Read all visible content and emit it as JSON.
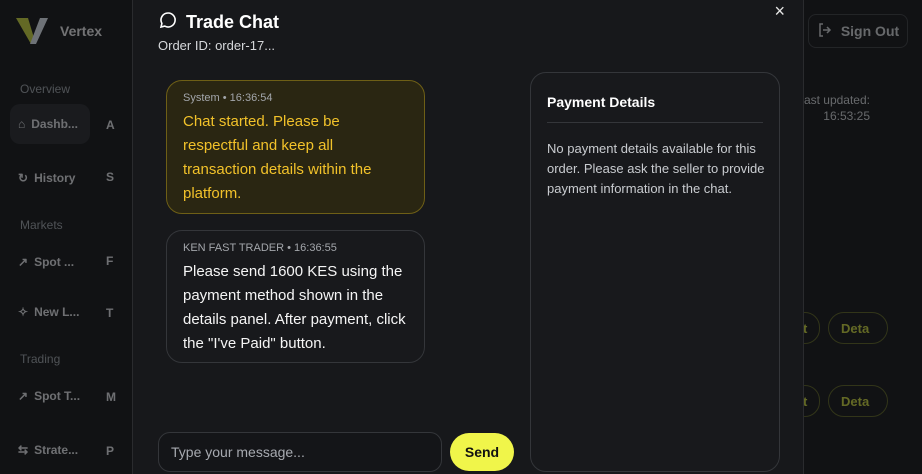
{
  "app": {
    "brand_name": "Vertex",
    "sign_out_label": "Sign Out"
  },
  "sidebar": {
    "sections": [
      "Overview",
      "Markets",
      "Trading"
    ],
    "items": [
      {
        "label": "Dashb..."
      },
      {
        "label": "History"
      },
      {
        "label": "Spot ..."
      },
      {
        "label": "New L..."
      },
      {
        "label": "Spot T..."
      },
      {
        "label": "Strate..."
      }
    ],
    "items_col2": [
      "A",
      "S",
      "F",
      "T",
      "M",
      "P"
    ]
  },
  "background": {
    "last_updated_label": "Last updated:",
    "last_updated_time": "16:53:25",
    "row_buttons": [
      "t",
      "Deta",
      "t",
      "Deta"
    ]
  },
  "modal": {
    "title": "Trade Chat",
    "order_id": "Order ID: order-17...",
    "close_label": "×",
    "messages": [
      {
        "sender": "System",
        "time": "16:36:54",
        "text": "Chat started. Please be respectful and keep all transaction details within the platform."
      },
      {
        "sender": "KEN FAST TRADER",
        "time": "16:36:55",
        "text": "Please send 1600 KES using the payment method shown in the details panel. After payment, click the \"I've Paid\" button."
      }
    ],
    "payment": {
      "title": "Payment Details",
      "text": "No payment details available for this order. Please ask the seller to provide payment information in the chat."
    },
    "input": {
      "placeholder": "Type your message...",
      "value": ""
    },
    "send_label": "Send"
  },
  "colors": {
    "accent": "#f0f54a",
    "system_bubble": "#2a2612",
    "system_text": "#f2c22a"
  }
}
